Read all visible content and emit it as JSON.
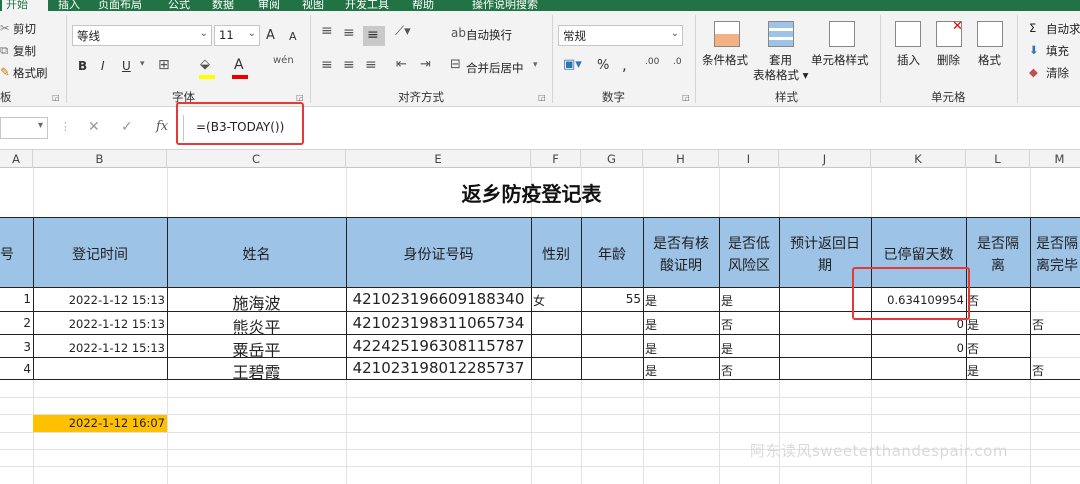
{
  "ribbon_tabs": [
    "开始",
    "插入",
    "页面布局",
    "公式",
    "数据",
    "审阅",
    "视图",
    "开发工具",
    "帮助",
    "操作说明搜索"
  ],
  "clipboard": {
    "cut": "剪切",
    "copy": "复制",
    "format_painter": "格式刷",
    "group": "板"
  },
  "font": {
    "name": "等线",
    "size": "11",
    "bold": "B",
    "italic": "I",
    "underline": "U",
    "group": "字体",
    "increase": "A",
    "decrease": "A",
    "phonetic": "wén"
  },
  "alignment": {
    "wrap": "自动换行",
    "merge": "合并后居中",
    "group": "对齐方式"
  },
  "number": {
    "format": "常规",
    "percent": "%",
    "comma": ",",
    "group": "数字",
    "inc_dec": ".00",
    "dec_dec": ".0"
  },
  "styles": {
    "conditional": "条件格式",
    "table_format": "套用\n表格格式",
    "cell_styles": "单元格样式",
    "group": "样式"
  },
  "cells": {
    "insert": "插入",
    "delete": "删除",
    "format": "格式",
    "group": "单元格"
  },
  "editing": {
    "autosum": "自动求",
    "fill": "填充",
    "clear": "清除"
  },
  "formula_bar": {
    "formula": "=(B3-TODAY())",
    "fx": "fx",
    "cancel": "✕",
    "enter": "✓"
  },
  "columns": [
    "A",
    "B",
    "C",
    "E",
    "F",
    "G",
    "H",
    "I",
    "J",
    "K",
    "L",
    "M"
  ],
  "sheet_title": "返乡防疫登记表",
  "headers": {
    "A": "号",
    "B": "登记时间",
    "C": "姓名",
    "E": "身份证号码",
    "F": "性别",
    "G": "年龄",
    "H1": "是否有核",
    "H2": "酸证明",
    "I1": "是否低",
    "I2": "风险区",
    "J1": "预计返回日",
    "J2": "期",
    "K": "已停留天数",
    "L1": "是否隔",
    "L2": "离",
    "M1": "是否隔",
    "M2": "离完毕"
  },
  "rows": [
    {
      "A": "1",
      "B": "2022-1-12 15:13",
      "C": "施海波",
      "E": "421023196609188340",
      "F": "女",
      "G": "55",
      "H": "是",
      "I": "是",
      "J": "",
      "K": "0.634109954",
      "L": "否",
      "M": ""
    },
    {
      "A": "2",
      "B": "2022-1-12 15:13",
      "C": "熊炎平",
      "E": "421023198311065734",
      "F": "",
      "G": "",
      "H": "是",
      "I": "否",
      "J": "",
      "K": "0",
      "L": "是",
      "M": "否"
    },
    {
      "A": "3",
      "B": "2022-1-12 15:13",
      "C": "粟岳平",
      "E": "422425196308115787",
      "F": "",
      "G": "",
      "H": "是",
      "I": "是",
      "J": "",
      "K": "0",
      "L": "否",
      "M": ""
    },
    {
      "A": "4",
      "B": "",
      "C": "王碧霞",
      "E": "421023198012285737",
      "F": "",
      "G": "",
      "H": "是",
      "I": "否",
      "J": "",
      "K": "",
      "L": "是",
      "M": "否"
    }
  ],
  "today_cell": "2022-1-12 16:07",
  "watermark": "阿东读风sweeterthandespair.com",
  "colors": {
    "excel_green": "#217346",
    "header_blue": "#9dc3e6",
    "today_fill": "#ffc000",
    "highlight_red": "#e53935"
  }
}
